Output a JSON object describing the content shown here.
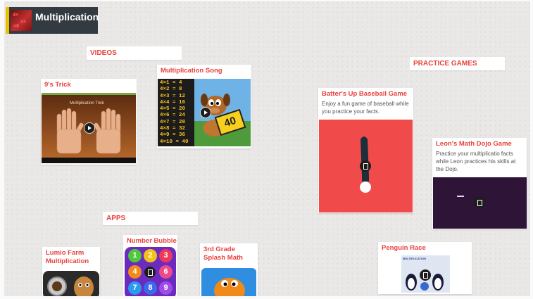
{
  "title": "Multiplication",
  "sections": {
    "videos": "VIDEOS",
    "practice_games": "PRACTICE GAMES",
    "apps": "APPS"
  },
  "cards": {
    "nines_trick": {
      "title": "9's Trick",
      "video_caption": "Multiplication Trick"
    },
    "mult_song": {
      "title": "Multiplication Song",
      "table": [
        "4×1 = 4",
        "4×2 = 8",
        "4×3 = 12",
        "4×4 = 16",
        "4×5 = 20",
        "4×6 = 24",
        "4×7 = 28",
        "4×8 = 32",
        "4×9 = 36",
        "4×10 = 40"
      ],
      "badge": "40"
    },
    "batters_up": {
      "title": "Batter's Up Baseball Game",
      "desc": "Enjoy a fun game of baseball while you practice your facts."
    },
    "leons_dojo": {
      "title": "Leon's Math Dojo Game",
      "desc": "Practice your multiplicatio facts while Leon practices his skills at the Dojo."
    },
    "lumio_farm": {
      "title": "Lumio Farm Multiplication"
    },
    "number_bubble": {
      "title": "Number Bubble",
      "bubbles": [
        "1",
        "2",
        "3",
        "4",
        "",
        "6",
        "7",
        "8",
        "9"
      ]
    },
    "splash_math": {
      "title": "3rd Grade Splash Math"
    },
    "penguin_race": {
      "title": "Penguin Race",
      "thumb_text": "MULTIPLICATION"
    }
  },
  "colors": {
    "accent": "#e8413c",
    "titlebar": "#333a42",
    "baseball_bg": "#f04a4a",
    "dojo_bg": "#2e1437"
  }
}
